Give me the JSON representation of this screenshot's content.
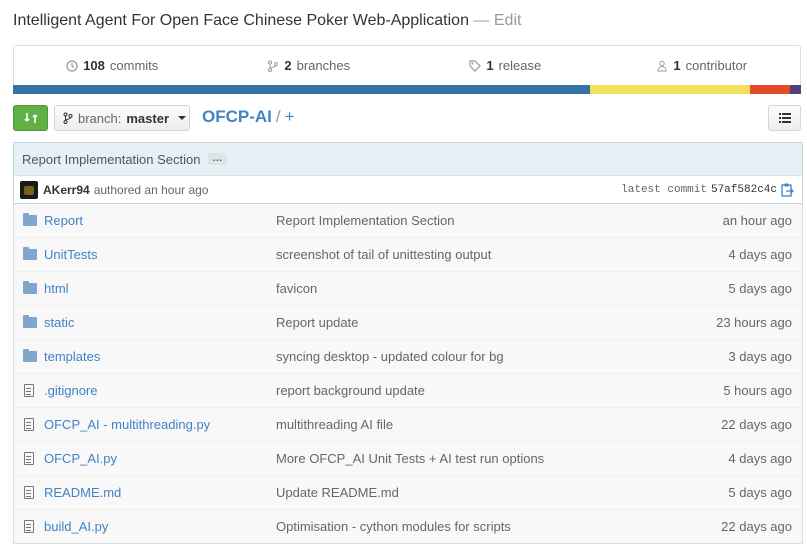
{
  "repo": {
    "description": "Intelligent Agent For Open Face Chinese Poker Web-Application",
    "edit_label": "— Edit",
    "name": "OFCP-AI",
    "add_label": "+"
  },
  "stats": {
    "commits": {
      "count": "108",
      "label": "commits"
    },
    "branches": {
      "count": "2",
      "label": "branches"
    },
    "releases": {
      "count": "1",
      "label": "release"
    },
    "contributors": {
      "count": "1",
      "label": "contributor"
    }
  },
  "languages": [
    {
      "color": "#3572a5",
      "percent": 73.2
    },
    {
      "color": "#f1e05a",
      "percent": 20.3
    },
    {
      "color": "#e34c26",
      "percent": 5.1
    },
    {
      "color": "#563d7c",
      "percent": 1.4
    }
  ],
  "branch": {
    "label": "branch:",
    "value": "master"
  },
  "latest_commit": {
    "message": "Report Implementation Section",
    "ellipsis": "…",
    "author": "AKerr94",
    "authored": "authored an hour ago",
    "label": "latest commit",
    "sha": "57af582c4c"
  },
  "files": [
    {
      "type": "folder",
      "name": "Report",
      "message": "Report Implementation Section",
      "age": "an hour ago"
    },
    {
      "type": "folder",
      "name": "UnitTests",
      "message": "screenshot of tail of unittesting output",
      "age": "4 days ago"
    },
    {
      "type": "folder",
      "name": "html",
      "message": "favicon",
      "age": "5 days ago"
    },
    {
      "type": "folder",
      "name": "static",
      "message": "Report update",
      "age": "23 hours ago"
    },
    {
      "type": "folder",
      "name": "templates",
      "message": "syncing desktop - updated colour for bg",
      "age": "3 days ago"
    },
    {
      "type": "file",
      "name": ".gitignore",
      "message": "report background update",
      "age": "5 hours ago"
    },
    {
      "type": "file",
      "name": "OFCP_AI - multithreading.py",
      "message": "multithreading AI file",
      "age": "22 days ago"
    },
    {
      "type": "file",
      "name": "OFCP_AI.py",
      "message": "More OFCP_AI Unit Tests + AI test run options",
      "age": "4 days ago"
    },
    {
      "type": "file",
      "name": "README.md",
      "message": "Update README.md",
      "age": "5 days ago"
    },
    {
      "type": "file",
      "name": "build_AI.py",
      "message": "Optimisation - cython modules for scripts",
      "age": "22 days ago"
    }
  ]
}
